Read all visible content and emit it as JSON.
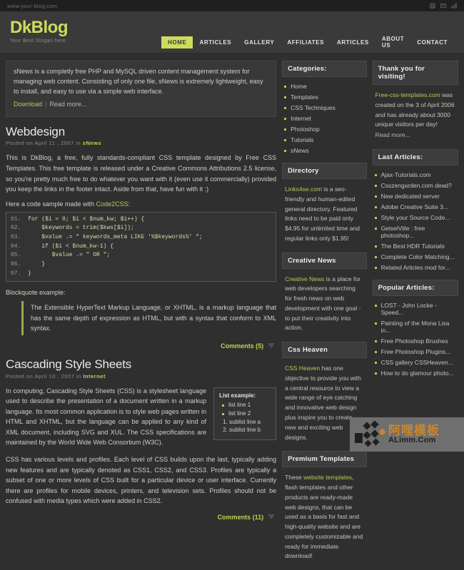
{
  "topbar": {
    "url": "www.your-blog.com",
    "icons": [
      "print-icon",
      "mail-icon",
      "rss-icon"
    ]
  },
  "header": {
    "logo": "DkBlog",
    "slogan": "Your Best Slogan here",
    "nav": [
      {
        "label": "HOME",
        "active": true
      },
      {
        "label": "ARTICLES",
        "active": false
      },
      {
        "label": "GALLERY",
        "active": false
      },
      {
        "label": "AFFILIATES",
        "active": false
      },
      {
        "label": "ARTICLES",
        "active": false
      },
      {
        "label": "ABOUT US",
        "active": false
      },
      {
        "label": "CONTACT",
        "active": false
      }
    ],
    "accent_color": "#cddc5c"
  },
  "intro": {
    "text": "sNews is a completly free PHP and MySQL driven content management system for managing web content. Consisting of only one file, sNews is extremely lightweight, easy to install, and easy to use via a simple web interface.",
    "download_label": "Download",
    "separator": "|",
    "readmore_label": "Read more..."
  },
  "posts": [
    {
      "title": "Webdesign",
      "meta_prefix": "Posted on April 11 , 2007 in",
      "meta_category": "sNews",
      "body": "This is DkBlog, a free, fully standards-compliant CSS template designed by Free CSS Templates. This free template is released under a Creative Commons Attributions 2.5 license, so you're pretty much free to do whatever you want with it (even use it commercially) provided you keep the links in the footer intact. Aside from that, have fun with it :)",
      "code_intro": "Here a code sample made with",
      "code_intro_link": "Code2CSS",
      "code_lines": [
        {
          "n": "01.",
          "t": "for ($i = 0; $i < $num_kw; $i++) {"
        },
        {
          "n": "02.",
          "t": "    $keywords = trim($kws[$i]);"
        },
        {
          "n": "03.",
          "t": "    $value .= \" keywords_meta LIKE '%$keywords%' \";"
        },
        {
          "n": "04.",
          "t": "    if ($i < $num_kw-1) {"
        },
        {
          "n": "05.",
          "t": "       $value .= \" OR \";"
        },
        {
          "n": "06.",
          "t": "    }"
        },
        {
          "n": "07.",
          "t": "}"
        }
      ],
      "blockquote_label": "Blockquote example:",
      "blockquote": "The Extensible HyperText Markup Language, or XHTML, is a markup language that has the same depth of expression as HTML, but with a syntax that conform to XML syntax.",
      "comments_label": "Comments (5)"
    },
    {
      "title": "Cascading Style Sheets",
      "meta_prefix": "Posted on April 10 , 2007 in",
      "meta_category": "Internet",
      "para1": "In computing, Cascading Style Sheets (CSS) is a stylesheet language used to describe the presentation of a document written in a markup language. Its most common application is to style web pages written in HTML and XHTML, but the language can be applied to any kind of XML document, including SVG and XUL. The CSS specifications are maintained by the World Wide Web Consortium (W3C).",
      "para2": "CSS has various levels and profiles. Each level of CSS builds upon the last, typically adding new features and are typically denoted as CSS1, CSS2, and CSS3. Profiles are typically a subset of one or more levels of CSS built for a particular device or user interface. Currently there are profiles for mobile devices, printers, and television sets. Profiles should not be confused with media types which were added in CSS2.",
      "listbox": {
        "title": "List example:",
        "items": [
          "list line 1",
          "list line 2"
        ],
        "sublist": [
          "sublist line a",
          "sublist line b"
        ]
      },
      "comments_label": "Comments (11)"
    }
  ],
  "sidebar_left": {
    "categories": {
      "title": "Categories:",
      "items": [
        "Home",
        "Templates",
        "CSS Techniques",
        "Internet",
        "Photoshop",
        "Tutorials",
        "sNews"
      ]
    },
    "directory": {
      "title": "Directory",
      "link": "Links4se.com",
      "text": " is a seo-friendly and human-edited general directory. Featured links need to be paid only $4.95 for unlimited time and regular links only $1.95!"
    },
    "creative_news": {
      "title": "Creative News",
      "link": "Creative News",
      "text": " is a place for web developers searching for fresh news on web development with one goal - to put their creativity into action."
    },
    "css_heaven": {
      "title": "Css Heaven",
      "link": "CSS Heaven",
      "text": " has one objective to provide you with a central resource to view a wide range of eye catching and innovative web design plus inspire you to create new and exciting web designs."
    },
    "premium_templates": {
      "title": "Premium Templates",
      "text_before": "These ",
      "link": "website templates",
      "text_after": ", flash templates and other products are ready-made web designs, that can be used as a basis for fast and high-quality website and are completely customizable and ready for immediate download!"
    }
  },
  "sidebar_right": {
    "thanks": {
      "title": "Thank you for visiting!",
      "link": "Free-css-templates.com",
      "text": " was created on the 3 of April 2006 and has already about 3000 unique visitors per day!",
      "readmore": "Read more..."
    },
    "last_articles": {
      "title": "Last Articles:",
      "items": [
        "Ajax-Tutorials.com",
        "Csszengarden.com dead?",
        "New dedicated server",
        "Adobe Creative Suite 3...",
        "Style your Source Code...",
        "GeiselVille : free photoshop...",
        "The Best HDR Tutorials",
        "Complete Color Matching...",
        "Related Articles mod for..."
      ]
    },
    "popular_articles": {
      "title": "Popular Articles:",
      "items": [
        "LOST - John Locke - Speed...",
        "Painting of the Mona Lisa in...",
        "Free Photoshop Brushes",
        "Free Photoshop Plugins...",
        "CSS gallery CSSHeaven...",
        "How to do glamour photo..."
      ]
    }
  },
  "watermark": {
    "cn": "阿哩模板",
    "en": "ALimm.Com"
  }
}
